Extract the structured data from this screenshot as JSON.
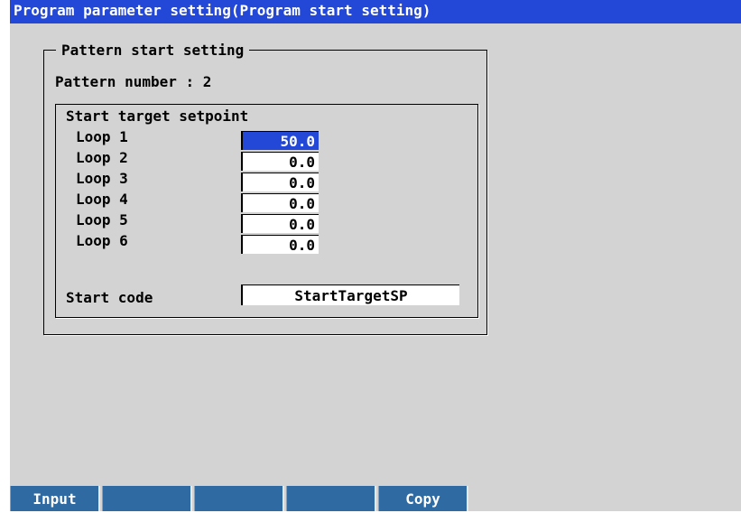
{
  "title": "Program parameter setting(Program start setting)",
  "group_title": "Pattern start setting",
  "pattern_label": "Pattern number :",
  "pattern_value": "2",
  "target_title": "Start target setpoint",
  "loops": [
    {
      "label": "Loop 1",
      "value": "50.0"
    },
    {
      "label": "Loop 2",
      "value": "0.0"
    },
    {
      "label": "Loop 3",
      "value": "0.0"
    },
    {
      "label": "Loop 4",
      "value": "0.0"
    },
    {
      "label": "Loop 5",
      "value": "0.0"
    },
    {
      "label": "Loop 6",
      "value": "0.0"
    }
  ],
  "start_code_label": "Start code",
  "start_code_value": "StartTargetSP",
  "softkeys": [
    "Input",
    "",
    "",
    "",
    "Copy"
  ],
  "colors": {
    "title_bg": "#2347d6",
    "softkey_bg": "#2f6aa2",
    "panel_bg": "#d3d3d3"
  }
}
